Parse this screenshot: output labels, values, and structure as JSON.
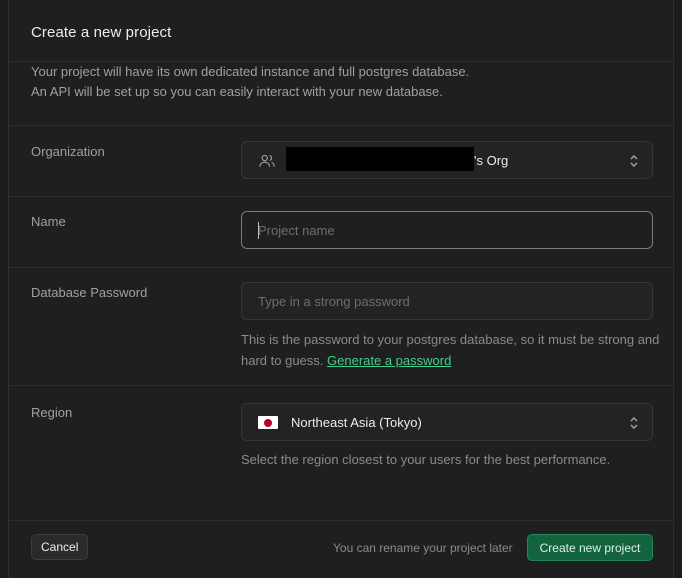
{
  "dialog": {
    "title": "Create a new project",
    "intro_line1": "Your project will have its own dedicated instance and full postgres database.",
    "intro_line2": "An API will be set up so you can easily interact with your new database."
  },
  "organization": {
    "label": "Organization",
    "value_suffix": "'s Org",
    "icon": "users-icon"
  },
  "name": {
    "label": "Name",
    "placeholder": "Project name",
    "value": ""
  },
  "password": {
    "label": "Database Password",
    "placeholder": "Type in a strong password",
    "help_text": "This is the password to your postgres database, so it must be strong and hard to guess.",
    "generate_link": "Generate a password"
  },
  "region": {
    "label": "Region",
    "value": "Northeast Asia (Tokyo)",
    "help_text": "Select the region closest to your users for the best performance."
  },
  "footer": {
    "cancel_label": "Cancel",
    "rename_note": "You can rename your project later",
    "create_label": "Create new project"
  },
  "colors": {
    "accent": "#3ecf8e",
    "primary_button": "#14633f",
    "background": "#1f1f1f"
  }
}
